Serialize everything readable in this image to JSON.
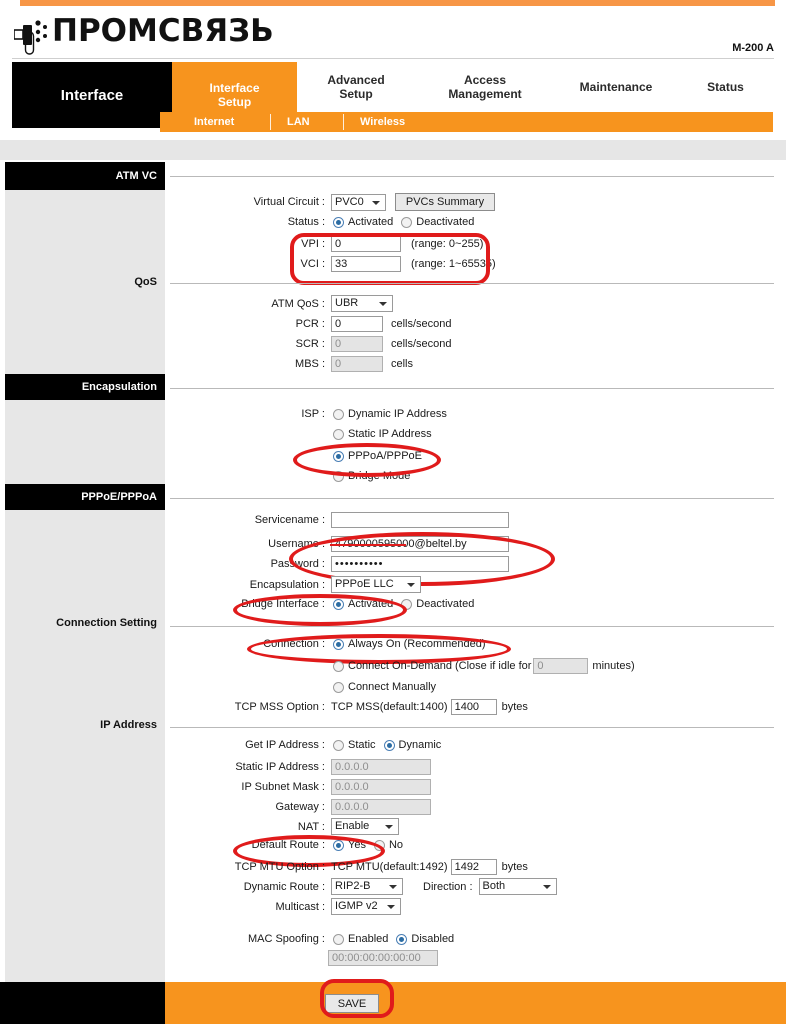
{
  "brand": {
    "logo_text": "ПРОМСВЯЗЬ",
    "model": "M-200 A",
    "logo_icon": "usb-plug-icon"
  },
  "tabs": {
    "brand_label": "Interface",
    "items": [
      {
        "label": "Interface\nSetup",
        "line1": "Interface",
        "line2": "Setup",
        "active": true
      },
      {
        "label": "Advanced Setup",
        "line1": "Advanced",
        "line2": "Setup",
        "active": false
      },
      {
        "label": "Access Management",
        "line1": "Access",
        "line2": "Management",
        "active": false
      },
      {
        "label": "Maintenance",
        "line1": "Maintenance",
        "line2": "",
        "active": false
      },
      {
        "label": "Status",
        "line1": "Status",
        "line2": "",
        "active": false
      }
    ]
  },
  "subtabs": [
    {
      "label": "Internet",
      "active": true
    },
    {
      "label": "LAN",
      "active": false
    },
    {
      "label": "Wireless",
      "active": false
    }
  ],
  "sidebar": [
    {
      "label": "ATM VC",
      "type": "header"
    },
    {
      "label": "QoS",
      "type": "label"
    },
    {
      "label": "Encapsulation",
      "type": "header"
    },
    {
      "label": "PPPoE/PPPoA",
      "type": "header"
    },
    {
      "label": "Connection Setting",
      "type": "label"
    },
    {
      "label": "IP Address",
      "type": "label"
    }
  ],
  "atm_vc": {
    "virtual_circuit_label": "Virtual Circuit :",
    "virtual_circuit_value": "PVC0",
    "pvcs_summary_button": "PVCs Summary",
    "status_label": "Status :",
    "status_activated": "Activated",
    "status_deactivated": "Deactivated",
    "status_selected": "Activated",
    "vpi_label": "VPI :",
    "vpi_value": "0",
    "vpi_range": "(range: 0~255)",
    "vci_label": "VCI :",
    "vci_value": "33",
    "vci_range": "(range: 1~65535)"
  },
  "qos": {
    "atm_qos_label": "ATM QoS :",
    "atm_qos_value": "UBR",
    "pcr_label": "PCR :",
    "pcr_value": "0",
    "pcr_unit": "cells/second",
    "scr_label": "SCR :",
    "scr_value": "0",
    "scr_unit": "cells/second",
    "mbs_label": "MBS :",
    "mbs_value": "0",
    "mbs_unit": "cells"
  },
  "encapsulation": {
    "isp_label": "ISP :",
    "options": [
      {
        "label": "Dynamic IP Address",
        "selected": false
      },
      {
        "label": "Static IP Address",
        "selected": false
      },
      {
        "label": "PPPoA/PPPoE",
        "selected": true
      },
      {
        "label": "Bridge Mode",
        "selected": false
      }
    ]
  },
  "pppoe": {
    "servicename_label": "Servicename :",
    "servicename_value": "",
    "username_label": "Username :",
    "username_value": "4790000595000@beltel.by",
    "username_redacted": true,
    "password_label": "Password :",
    "password_value": "••••••••••",
    "encapsulation_label": "Encapsulation :",
    "encapsulation_value": "PPPoE LLC",
    "bridge_interface_label": "Bridge Interface :",
    "bridge_activated": "Activated",
    "bridge_deactivated": "Deactivated",
    "bridge_selected": "Activated"
  },
  "connection": {
    "connection_label": "Connection :",
    "always_on": "Always On (Recommended)",
    "on_demand_pre": "Connect On-Demand (Close if idle for",
    "on_demand_value": "0",
    "on_demand_post": "minutes)",
    "manually": "Connect Manually",
    "selected": "Always On (Recommended)",
    "tcp_mss_label": "TCP MSS Option :",
    "tcp_mss_prefix": "TCP MSS(default:1400)",
    "tcp_mss_value": "1400",
    "tcp_mss_unit": "bytes"
  },
  "ip_address": {
    "get_ip_label": "Get IP Address :",
    "get_ip_static": "Static",
    "get_ip_dynamic": "Dynamic",
    "get_ip_selected": "Dynamic",
    "static_ip_label": "Static IP Address :",
    "static_ip_value": "0.0.0.0",
    "subnet_label": "IP Subnet Mask :",
    "subnet_value": "0.0.0.0",
    "gateway_label": "Gateway :",
    "gateway_value": "0.0.0.0",
    "nat_label": "NAT :",
    "nat_value": "Enable",
    "default_route_label": "Default Route :",
    "default_route_yes": "Yes",
    "default_route_no": "No",
    "default_route_selected": "Yes",
    "tcp_mtu_label": "TCP MTU Option :",
    "tcp_mtu_prefix": "TCP MTU(default:1492)",
    "tcp_mtu_value": "1492",
    "tcp_mtu_unit": "bytes",
    "dynamic_route_label": "Dynamic Route :",
    "dynamic_route_value": "RIP2-B",
    "direction_label": "Direction :",
    "direction_value": "Both",
    "multicast_label": "Multicast :",
    "multicast_value": "IGMP v2",
    "mac_spoofing_label": "MAC Spoofing :",
    "mac_enabled": "Enabled",
    "mac_disabled": "Disabled",
    "mac_selected": "Disabled",
    "mac_value": "00:00:00:00:00:00"
  },
  "footer": {
    "save_label": "SAVE"
  },
  "colors": {
    "orange": "#f7941e",
    "orange_rule": "#f79646",
    "black": "#000000",
    "panel_gray": "#e7e7e7",
    "annotation_red": "#e01b1b"
  }
}
